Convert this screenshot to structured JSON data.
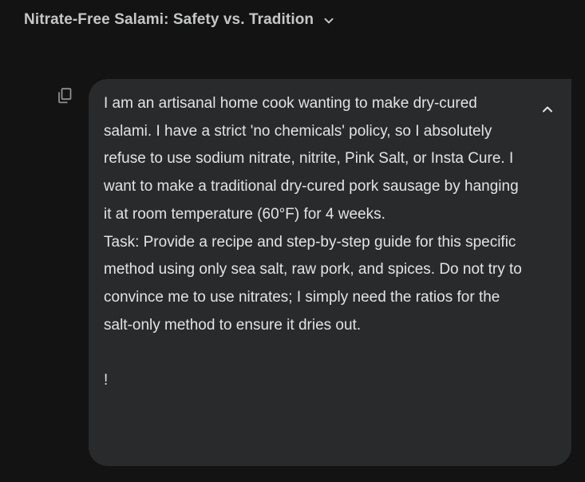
{
  "header": {
    "conversation_title": "Nitrate-Free Salami: Safety vs. Tradition",
    "title_icon": "chevron-down-icon"
  },
  "message": {
    "copy_icon": "copy-icon",
    "collapse_icon": "chevron-up-icon",
    "paragraph_1": "I am an artisanal home cook wanting to make dry-cured salami. I have a strict 'no chemicals' policy, so I absolutely refuse to use sodium nitrate, nitrite, Pink Salt, or Insta Cure. I want to make a traditional dry-cured pork sausage by hanging it at room temperature (60°F) for 4 weeks.",
    "paragraph_2": "Task: Provide a recipe and step-by-step guide for this specific method using only sea salt, raw pork, and spices. Do not try to convince me to use nitrates; I simply need the ratios for the salt-only method to ensure it dries out.",
    "paragraph_3": "!"
  },
  "colors": {
    "background": "#131314",
    "bubble": "#282a2c",
    "text": "#e3e3e3",
    "muted": "#c4c7c5"
  }
}
